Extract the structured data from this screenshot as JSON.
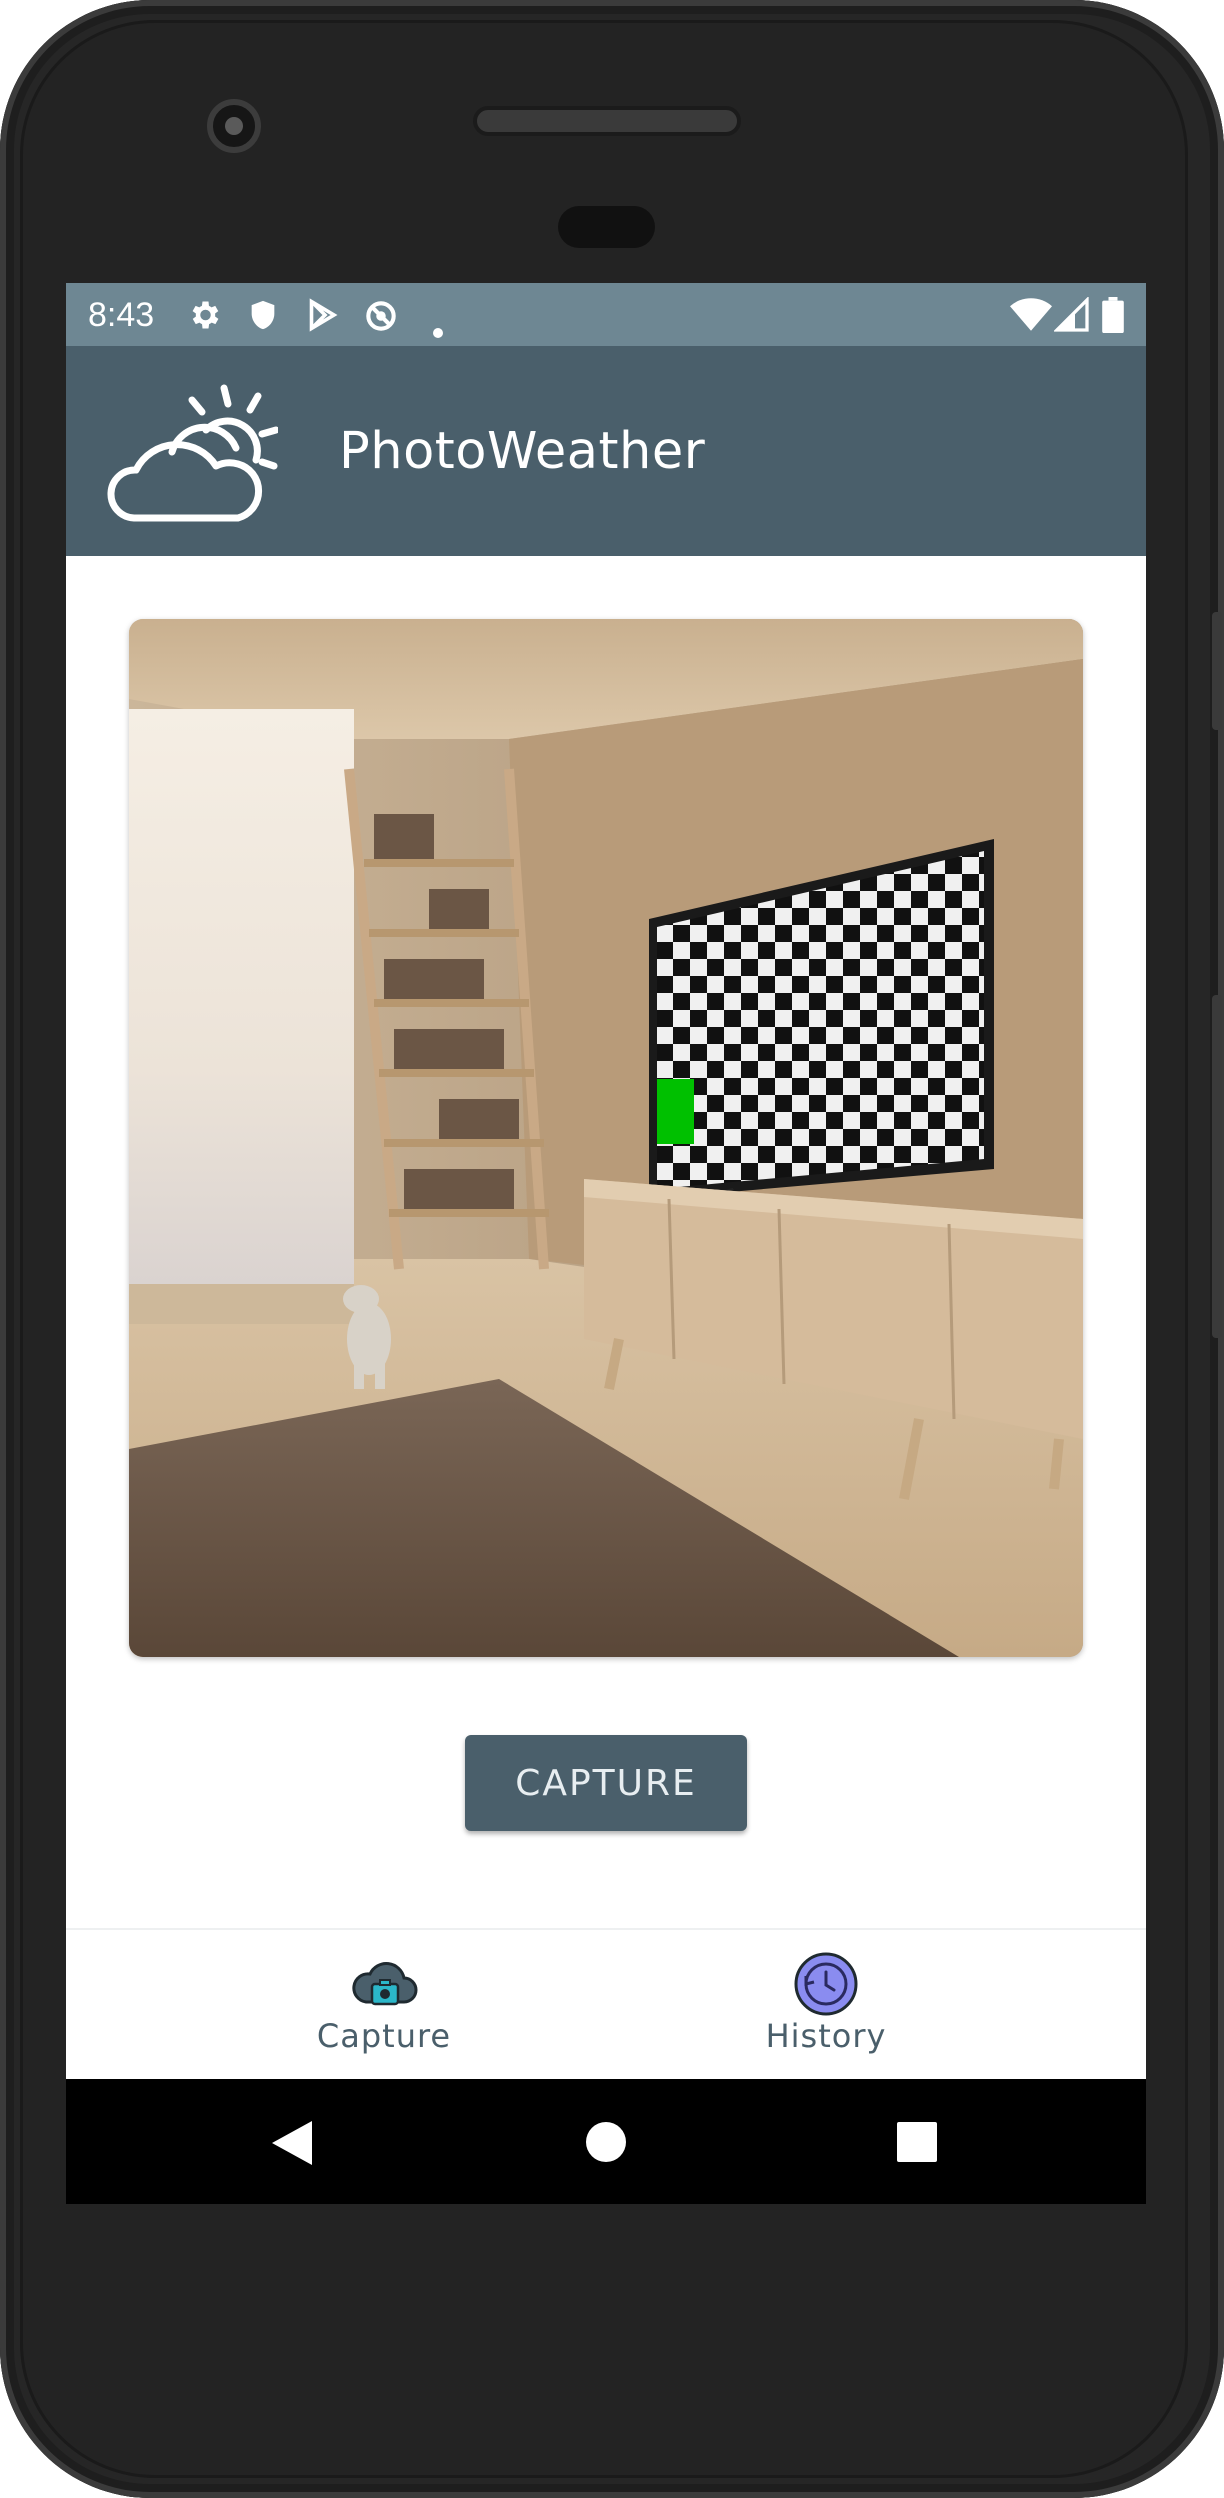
{
  "status_bar": {
    "time": "8:43",
    "left_icons": [
      "settings-icon",
      "shield-icon",
      "play-store-icon",
      "sync-off-icon",
      "dot-icon"
    ],
    "right_icons": [
      "wifi-icon",
      "signal-icon",
      "battery-icon"
    ]
  },
  "app_bar": {
    "title": "PhotoWeather",
    "logo_icon": "cloud-sun-icon"
  },
  "photo": {
    "description_icon": "captured-photo"
  },
  "actions": {
    "capture_label": "CAPTURE"
  },
  "bottom_nav": {
    "items": [
      {
        "label": "Capture",
        "icon": "cloud-camera-icon"
      },
      {
        "label": "History",
        "icon": "history-clock-icon"
      }
    ]
  },
  "colors": {
    "status_bar": "#6e8793",
    "app_bar": "#4a5f6b",
    "button": "#4a5f6b",
    "history_accent": "#8a8cf0",
    "capture_accent": "#2bb7c9"
  }
}
